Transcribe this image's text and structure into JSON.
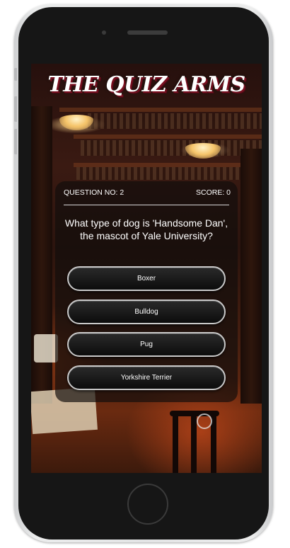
{
  "app": {
    "title": "THE QUIZ ARMS"
  },
  "quiz": {
    "question_number_label": "QUESTION NO: 2",
    "score_label": "SCORE: 0",
    "question_text": "What type of dog is 'Handsome Dan', the mascot of Yale University?",
    "answers": [
      {
        "label": "Boxer"
      },
      {
        "label": "Bulldog"
      },
      {
        "label": "Pug"
      },
      {
        "label": "Yorkshire Terrier"
      }
    ]
  },
  "colors": {
    "title_shadow": "#7a1020",
    "card_background": "#120e0c",
    "button_border": "#c9c9c9",
    "phone_frame": "#161616"
  },
  "icons": {
    "loading_ring": "ring-icon"
  }
}
